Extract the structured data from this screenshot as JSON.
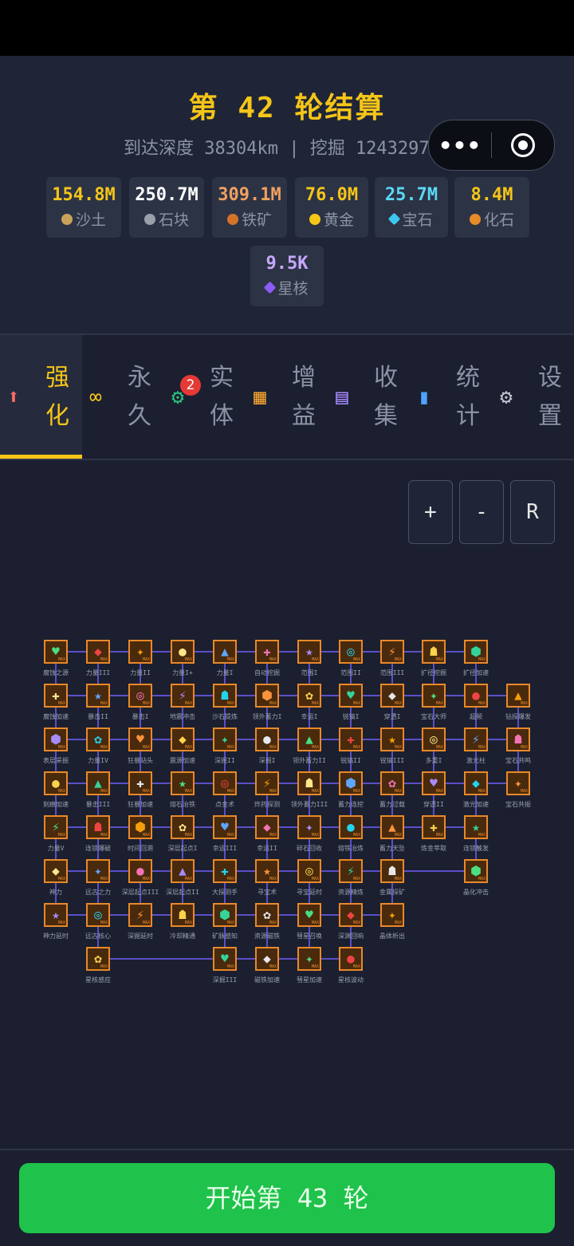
{
  "header": {
    "title": "第 42 轮结算",
    "subtitle": "到达深度 38304km | 挖掘 1243297 块",
    "more_button": "•••"
  },
  "resources": [
    {
      "value": "154.8M",
      "label": "沙土",
      "color": "#f5c518",
      "icon": "sand-icon",
      "icon_color": "#c9a25a"
    },
    {
      "value": "250.7M",
      "label": "石块",
      "color": "#ffffff",
      "icon": "stone-icon",
      "icon_color": "#9aa0aa"
    },
    {
      "value": "309.1M",
      "label": "铁矿",
      "color": "#f0a060",
      "icon": "iron-ore-icon",
      "icon_color": "#d3732a"
    },
    {
      "value": "76.0M",
      "label": "黄金",
      "color": "#f5c518",
      "icon": "gold-icon",
      "icon_color": "#f5c518"
    },
    {
      "value": "25.7M",
      "label": "宝石",
      "color": "#5ad8f5",
      "icon": "gem-icon",
      "icon_color": "#3ec7ee"
    },
    {
      "value": "8.4M",
      "label": "化石",
      "color": "#f5c518",
      "icon": "fossil-icon",
      "icon_color": "#e8892a"
    },
    {
      "value": "9.5K",
      "label": "星核",
      "color": "#c8a8ff",
      "icon": "star-core-icon",
      "icon_color": "#8b5cf6"
    }
  ],
  "tabs": [
    {
      "label1": "强",
      "label2": "化",
      "icon": "upgrade-arrow-icon",
      "glyph": "⬆",
      "color": "#ff6b6b"
    },
    {
      "label1": "永",
      "label2": "久",
      "icon": "infinity-icon",
      "glyph": "∞",
      "color": "#f5c518"
    },
    {
      "label1": "实",
      "label2": "体",
      "icon": "gear-green-icon",
      "glyph": "⚙",
      "color": "#2ec27e"
    },
    {
      "label1": "增",
      "label2": "益",
      "icon": "shop-icon",
      "glyph": "▦",
      "color": "#f0a030"
    },
    {
      "label1": "收",
      "label2": "集",
      "icon": "book-icon",
      "glyph": "▤",
      "color": "#a98bff"
    },
    {
      "label1": "统",
      "label2": "计",
      "icon": "bar-chart-icon",
      "glyph": "▮",
      "color": "#4da3ff"
    },
    {
      "label1": "设",
      "label2": "置",
      "icon": "settings-icon",
      "glyph": "⚙",
      "color": "#c0c4cc"
    }
  ],
  "entity_badge": "2",
  "zoom": {
    "plus": "+",
    "minus": "-",
    "reset": "R"
  },
  "upgrade_rows": [
    [
      "腐蚀之源",
      "力量III",
      "力量II",
      "力量I+",
      "力量I",
      "自动挖掘",
      "范围I",
      "范围II",
      "范围III",
      "扩径挖掘",
      "扩径加速"
    ],
    [
      "腐蚀加速",
      "暴击II",
      "暴击I",
      "地震冲击",
      "沙石提炼",
      "领外蓄力I",
      "幸运I",
      "锐镐I",
      "穿透I",
      "宝石大师",
      "超频",
      "钻探爆发"
    ],
    [
      "表层采掘",
      "力量IV",
      "狂暴站头",
      "震源加速",
      "深掘II",
      "深掘I",
      "领外蓄力II",
      "锐镐II",
      "锐镐III",
      "多重I",
      "激光柱",
      "宝石共鸣"
    ],
    [
      "刻痕加速",
      "暴击III",
      "狂暴加速",
      "熔石治铁",
      "点金术",
      "炸药探测",
      "领外蓄力III",
      "蓄力连挖",
      "蓄力过载",
      "穿透II",
      "激光加速",
      "宝石共振"
    ],
    [
      "力量V",
      "连锁爆破",
      "时间回溯",
      "深层起点I",
      "幸运III",
      "幸运II",
      "碎石回收",
      "熔铁冶炼",
      "蓄力天坠",
      "炼金萃取",
      "连锁触发"
    ],
    [
      "神力",
      "远古之力",
      "深层起点III",
      "深层起点II",
      "大探测手",
      "寻宝术",
      "寻宝延时",
      "资源精炼",
      "金属探矿",
      "晶化冲击"
    ],
    [
      "神力延时",
      "远古核心",
      "深掘延时",
      "冷却精通",
      "矿脉感知",
      "资源磁铁",
      "彗星召唤",
      "深渊回响",
      "晶体析出"
    ],
    [
      "星核感应",
      "深掘III",
      "磁铁加速",
      "彗星加速",
      "星核波动"
    ]
  ],
  "start_button": "开始第 43 轮"
}
